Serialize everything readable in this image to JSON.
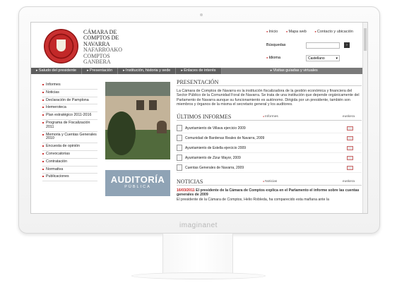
{
  "org": {
    "line1": "CÁMARA DE",
    "line2": "COMPTOS DE",
    "line3": "NAVARRA",
    "line4": "NAFARROAKO",
    "line5": "COMPTOS",
    "line6": "GANBERA"
  },
  "top": {
    "inicio": "Inicio",
    "mapa": "Mapa web",
    "contacto": "Contacto y ubicación",
    "busqueda": "Búsquedas",
    "idioma": "Idioma",
    "lang": "Castellano"
  },
  "nav": [
    "Saludo del presidente",
    "Presentación",
    "Institución, historia y sede",
    "Enlaces de interés",
    "Visitas guiadas y virtuales"
  ],
  "sidebar": [
    "Informes",
    "Noticias",
    "Declaración de Pamplona",
    "Hemeroteca",
    "Plan estratégico 2011-2016",
    "Programa de Fiscalización 2011",
    "Memoria y Cuentas Generales 2010",
    "Encuesta de opinión",
    "Convocatorias",
    "Contratación",
    "Normativa",
    "Publicaciones"
  ],
  "audit": {
    "title": "AUDITORÍA",
    "subtitle": "PÚBLICA"
  },
  "content": {
    "presentacion": "PRESENTACIÓN",
    "intro": "La Cámara de Comptos de Navarra es la institución fiscalizadora de la gestión económica y financiera del Sector Público de la Comunidad Foral de Navarra. Se trata de una institución que depende orgánicamente del Parlamento de Navarra aunque su funcionamiento es autónomo. Dirigida por un presidente, también son miembros y órganos de la misma el secretario general y los auditores.",
    "ultimos": "ÚLTIMOS INFORMES",
    "informes_link": "Informes",
    "euskera": "euskera",
    "reports": [
      "Ayuntamiento de Villava ejercicio 2009",
      "Comunidad de Bardenas Reales de Navarra, 2009",
      "Ayuntamiento de Estella ejercicio 2009",
      "Ayuntamiento de Zizur Mayor, 2009",
      "Cuentas Generales de Navarra, 2009"
    ],
    "noticias": "NOTICIAS",
    "noticias_link": "Noticias",
    "news_date": "16/03/2011",
    "news_title": "El presidente de la Cámara de Comptos explica en el Parlamento el informe sobre las cuentas generales de 2009",
    "news_body": "El presidente de la Cámara de Comptos, Helio Robleda, ha comparecido esta mañana ante la"
  },
  "brand": "imaginanet"
}
